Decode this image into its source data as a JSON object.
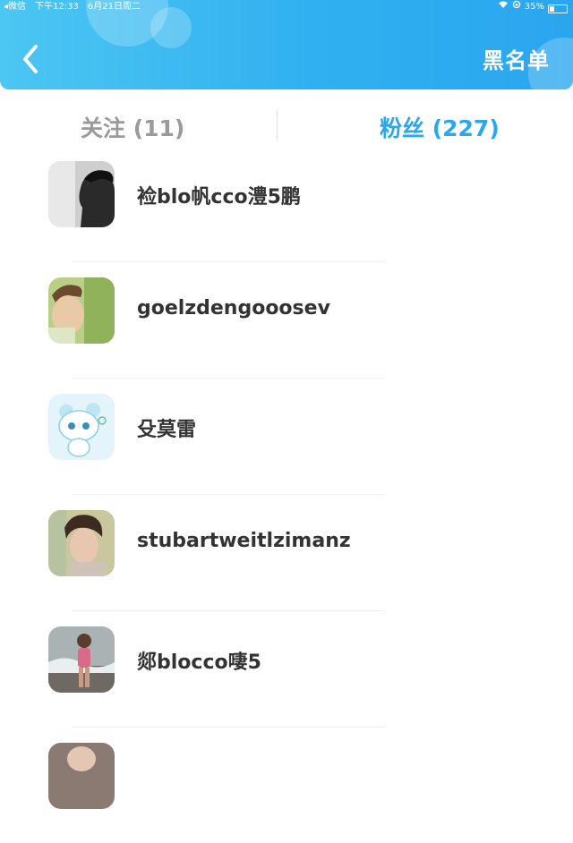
{
  "status_bar": {
    "carrier": "◂微信",
    "time": "下午12:33",
    "date": "6月21日周二",
    "battery_text": "35%",
    "battery_level": 0.35
  },
  "header": {
    "back_icon": "chevron-left-icon",
    "right_action": "黑名单",
    "colors": {
      "gradient_start": "#4cc6f2",
      "gradient_end": "#2aa6ef"
    }
  },
  "tabs": [
    {
      "label": "关注 (11)",
      "active": false
    },
    {
      "label": "粉丝 (227)",
      "active": true,
      "color": "#2aa7ee"
    }
  ],
  "fans": [
    {
      "name": "裣blo帆cco澧5鹏",
      "avatar": "grayscale-man-profile-photo"
    },
    {
      "name": "goelzdengooosev",
      "avatar": "young-man-photo"
    },
    {
      "name": "殳莫雷",
      "avatar": "cartoon-cat-photo"
    },
    {
      "name": "stubartweitlzimanz",
      "avatar": "painted-man-portrait"
    },
    {
      "name": "郯blocco啛5",
      "avatar": "girl-at-beach-photo"
    },
    {
      "name": "",
      "avatar": "partial-avatar"
    }
  ]
}
